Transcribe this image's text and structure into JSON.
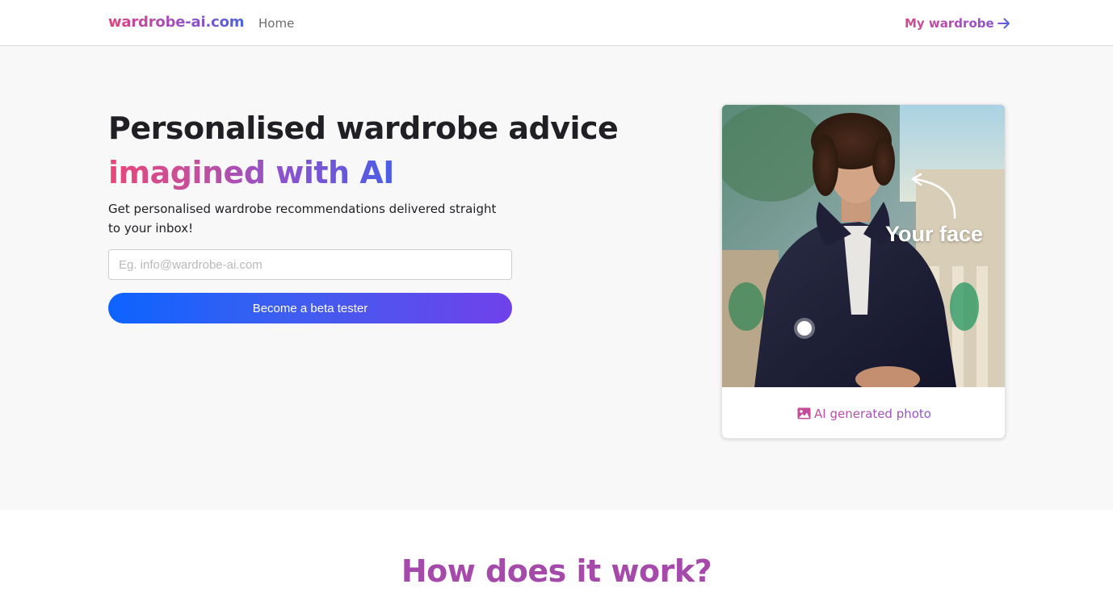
{
  "navbar": {
    "brand": "wardrobe-ai.com",
    "home_label": "Home",
    "wardrobe_label": "My wardrobe",
    "wardrobe_icon": "arrow-right-icon"
  },
  "hero": {
    "headline": "Personalised wardrobe advice",
    "headline_accent": "imagined with AI",
    "subtext": "Get personalised wardrobe recommendations delivered straight to your inbox!",
    "email_placeholder": "Eg. info@wardrobe-ai.com",
    "email_value": "",
    "cta_label": "Become a beta tester"
  },
  "card": {
    "overlay_label": "Your face",
    "caption": "AI generated photo",
    "caption_icon": "image-icon"
  },
  "how": {
    "title": "How does it work?"
  },
  "colors": {
    "accent_pink": "#e0457b",
    "accent_purple": "#8d52d1",
    "accent_blue": "#0d63ff",
    "hero_bg": "#f8f8f8"
  }
}
